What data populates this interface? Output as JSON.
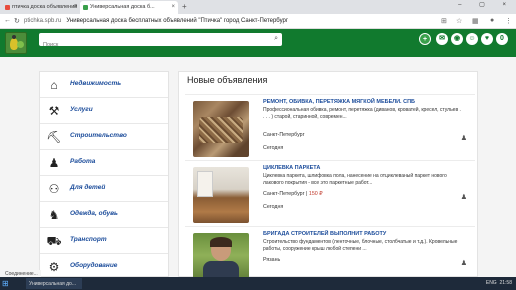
{
  "browser": {
    "tabs": [
      {
        "label": "птичка доска объявлений",
        "active": false
      },
      {
        "label": "Универсальная доска б...",
        "active": true
      }
    ],
    "url_domain": "ptichka.spb.ru",
    "page_title": "Универсальная доска бесплатных объявлений \"Птичка\" город Санкт-Петербург"
  },
  "header": {
    "search_placeholder": "Поиск",
    "buttons": [
      "add-icon",
      "message-icon",
      "camera-icon",
      "person-icon",
      "heart-icon",
      "count-badge"
    ],
    "count": "0"
  },
  "sidebar": {
    "categories": [
      {
        "label": "Недвижимость",
        "icon": "house-icon",
        "glyph": "⌂"
      },
      {
        "label": "Услуги",
        "icon": "worker-icon",
        "glyph": "⚒"
      },
      {
        "label": "Строительство",
        "icon": "builder-icon",
        "glyph": "⛏"
      },
      {
        "label": "Работа",
        "icon": "office-icon",
        "glyph": "♟"
      },
      {
        "label": "Для детей",
        "icon": "stroller-icon",
        "glyph": "⚇"
      },
      {
        "label": "Одежда, обувь",
        "icon": "clothing-icon",
        "glyph": "♞"
      },
      {
        "label": "Транспорт",
        "icon": "car-icon",
        "glyph": "⛟"
      },
      {
        "label": "Оборудование",
        "icon": "equipment-icon",
        "glyph": "⚙"
      }
    ]
  },
  "main": {
    "title": "Новые объявления",
    "listings": [
      {
        "title": "РЕМОНТ, ОБИВКА, ПЕРЕТЯЖКА МЯГКОЙ МЕБЕЛИ. СПБ",
        "desc": "Профессиональная обивка, ремонт, перетяжка (диванов, кроватей, кресел, стульев . . . . ) старой, старинной, современ...",
        "city": "Санкт-Петербург",
        "price": "",
        "date": "Сегодня"
      },
      {
        "title": "ЦИКЛЕВКА ПАРКЕТА",
        "desc": "Циклевка паркета, шлифовка пола, нанесение на отциклеваный паркет нового лакового покрытия - все это паркетные работ...",
        "city": "Санкт-Петербург",
        "price": "150 ₽",
        "date": "Сегодня"
      },
      {
        "title": "БРИГАДА СТРОИТЕЛЕЙ ВЫПОЛНИТ РАБОТУ",
        "desc": "Строительство фундаментов (ленточные, блочные, столбчатые и т.д.). Кровельные работы, сооружение крыш любой степени ...",
        "city": "Рязань",
        "price": "",
        "date": ""
      }
    ]
  },
  "status_text": "Соединение...",
  "taskbar": {
    "item": "Универсальная до...",
    "time": "21:58"
  }
}
